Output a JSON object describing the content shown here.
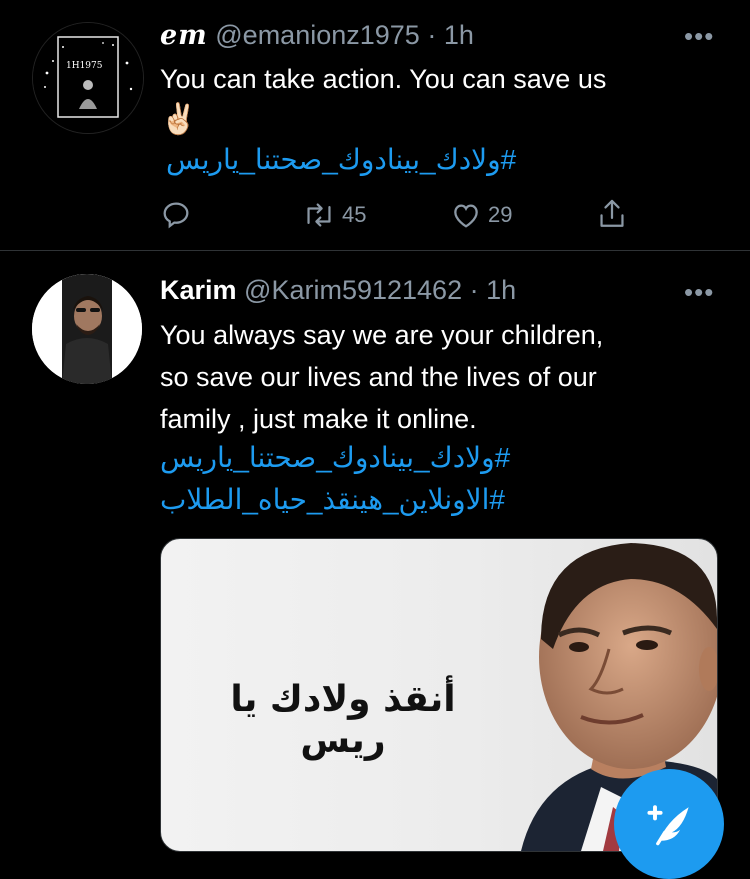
{
  "tweets": [
    {
      "author_name": "em",
      "handle": "@emanionz1975",
      "separator": "·",
      "time": "1h",
      "text": "You can take action. You can save us",
      "emoji": "✌🏻",
      "hashtags": [
        "#ولادك_بينادوك_صحتنا_ياريس"
      ],
      "avatar_text": "1H1975",
      "retweets": "45",
      "likes": "29"
    },
    {
      "author_name": "Karim",
      "handle": "@Karim59121462",
      "separator": "·",
      "time": "1h",
      "text_lines": [
        "You always say we are your children,",
        "so save our lives and the lives of our",
        "family , just make it online."
      ],
      "hashtags": [
        "#ولادك_بينادوك_صحتنا_ياريس",
        "#الاونلاين_هينقذ_حياه_الطلاب"
      ],
      "media_caption": "أنقذ ولادك يا ريس"
    }
  ],
  "more_label": "•••",
  "icons": {
    "reply": "reply-icon",
    "retweet": "retweet-icon",
    "like": "heart-icon",
    "share": "share-icon",
    "compose": "compose-tweet-icon"
  },
  "colors": {
    "background": "#000000",
    "accent": "#1d9bf0",
    "secondary_text": "#8b98a5",
    "divider": "#2f3336"
  }
}
